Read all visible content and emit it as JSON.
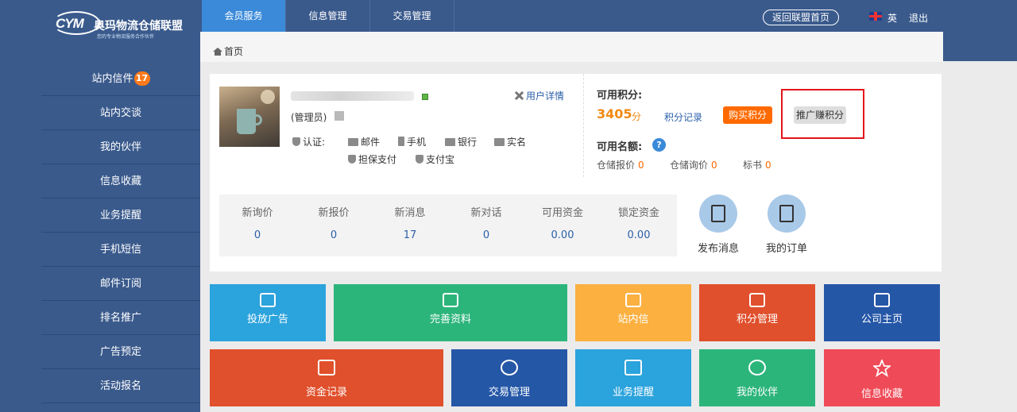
{
  "brand": {
    "logo_mark": "CYM",
    "name": "奥玛物流仓储联盟",
    "tagline": "您的专业物流服务合作伙伴"
  },
  "tabs": [
    {
      "label": "会员服务",
      "active": true
    },
    {
      "label": "信息管理",
      "active": false
    },
    {
      "label": "交易管理",
      "active": false
    }
  ],
  "top_links": {
    "home": "返回联盟首页",
    "lang": "英",
    "logout": "退出"
  },
  "sidebar": {
    "items": [
      {
        "label": "站内信件",
        "badge": "17"
      },
      {
        "label": "站内交谈"
      },
      {
        "label": "我的伙伴"
      },
      {
        "label": "信息收藏"
      },
      {
        "label": "业务提醒"
      },
      {
        "label": "手机短信"
      },
      {
        "label": "邮件订阅"
      },
      {
        "label": "排名推广"
      },
      {
        "label": "广告预定"
      },
      {
        "label": "活动报名"
      }
    ]
  },
  "breadcrumb": "首页",
  "user": {
    "role": "(管理员)",
    "detail_link": "用户详情",
    "cert_label": "认证:",
    "certs": [
      "邮件",
      "手机",
      "银行",
      "实名",
      "担保支付",
      "支付宝"
    ]
  },
  "points": {
    "title": "可用积分:",
    "value": "3405",
    "unit": "分",
    "log_link": "积分记录",
    "buy": "购买积分",
    "promo": "推广赚积分"
  },
  "quota": {
    "title": "可用名额:",
    "help": "?",
    "items": [
      {
        "label": "仓储报价",
        "value": "0"
      },
      {
        "label": "仓储询价",
        "value": "0"
      },
      {
        "label": "标书",
        "value": "0"
      }
    ]
  },
  "stats": [
    {
      "label": "新询价",
      "value": "0"
    },
    {
      "label": "新报价",
      "value": "0"
    },
    {
      "label": "新消息",
      "value": "17"
    },
    {
      "label": "新对话",
      "value": "0"
    },
    {
      "label": "可用资金",
      "value": "0.00"
    },
    {
      "label": "锁定资金",
      "value": "0.00"
    }
  ],
  "quick": [
    {
      "label": "发布消息",
      "icon": "publish-icon"
    },
    {
      "label": "我的订单",
      "icon": "order-bag-icon"
    }
  ],
  "tiles_row1": [
    {
      "label": "投放广告",
      "color": "#2ba3dc",
      "icon": "edit-icon"
    },
    {
      "label": "完善资料",
      "color": "#2cb57b",
      "icon": "books-icon"
    },
    {
      "label": "站内信",
      "color": "#fbb040",
      "icon": "inbox-icon"
    },
    {
      "label": "积分管理",
      "color": "#e0502c",
      "icon": "browser-icon"
    },
    {
      "label": "公司主页",
      "color": "#2557a7",
      "icon": "home-icon"
    }
  ],
  "tiles_row2": [
    {
      "label": "资金记录",
      "color": "#e0502c",
      "icon": "clipboard-icon"
    },
    {
      "label": "交易管理",
      "color": "#2557a7",
      "icon": "dollar-icon"
    },
    {
      "label": "业务提醒",
      "color": "#2ba3dc",
      "icon": "calendar-icon"
    },
    {
      "label": "我的伙伴",
      "color": "#2cb57b",
      "icon": "partners-icon"
    },
    {
      "label": "信息收藏",
      "color": "#ef4a57",
      "icon": "star-icon"
    }
  ]
}
